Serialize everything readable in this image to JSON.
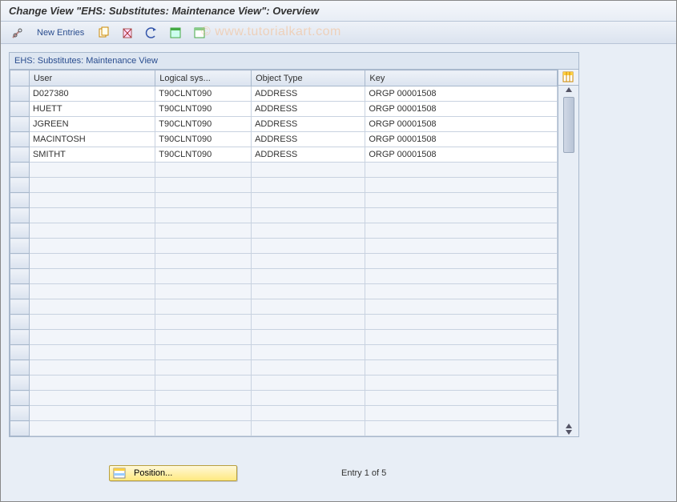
{
  "title": "Change View \"EHS: Substitutes: Maintenance View\": Overview",
  "watermark": "© www.tutorialkart.com",
  "toolbar": {
    "new_entries_label": "New Entries"
  },
  "panel": {
    "title": "EHS: Substitutes: Maintenance View"
  },
  "table": {
    "columns": {
      "user": "User",
      "logical_system": "Logical sys...",
      "object_type": "Object Type",
      "key": "Key"
    },
    "rows": [
      {
        "user": "D027380",
        "logical_system": "T90CLNT090",
        "object_type": "ADDRESS",
        "key": "ORGP 00001508"
      },
      {
        "user": "HUETT",
        "logical_system": "T90CLNT090",
        "object_type": "ADDRESS",
        "key": "ORGP 00001508"
      },
      {
        "user": "JGREEN",
        "logical_system": "T90CLNT090",
        "object_type": "ADDRESS",
        "key": "ORGP 00001508"
      },
      {
        "user": "MACINTOSH",
        "logical_system": "T90CLNT090",
        "object_type": "ADDRESS",
        "key": "ORGP 00001508"
      },
      {
        "user": "SMITHT",
        "logical_system": "T90CLNT090",
        "object_type": "ADDRESS",
        "key": "ORGP 00001508"
      }
    ],
    "empty_rows": 18
  },
  "footer": {
    "position_label": "Position...",
    "entry_text": "Entry 1 of 5"
  }
}
